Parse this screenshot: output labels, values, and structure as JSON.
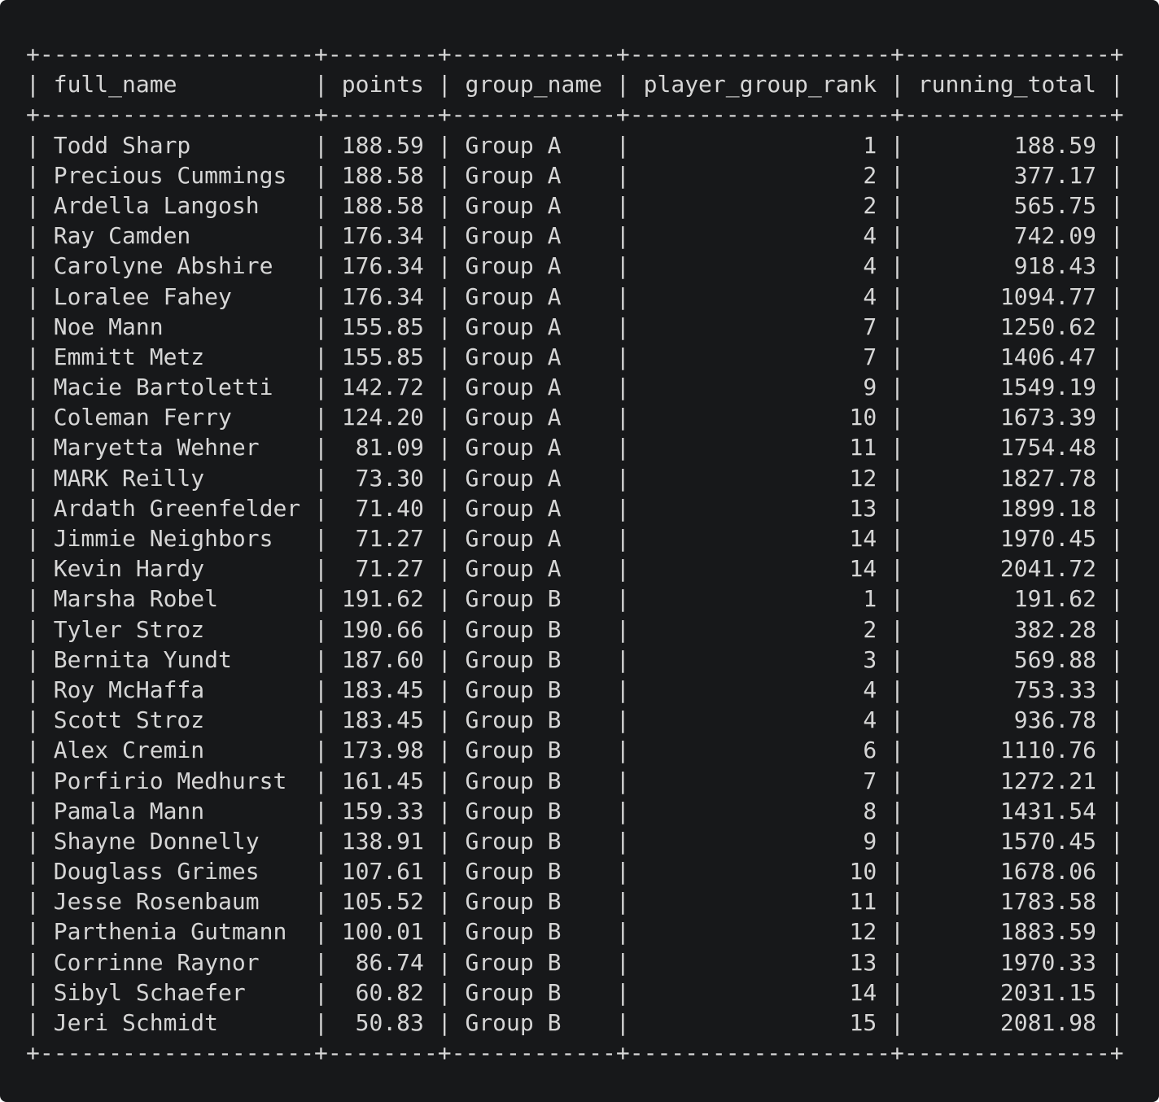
{
  "columns": [
    {
      "name": "full_name",
      "align": "left"
    },
    {
      "name": "points",
      "align": "right"
    },
    {
      "name": "group_name",
      "align": "left"
    },
    {
      "name": "player_group_rank",
      "align": "right"
    },
    {
      "name": "running_total",
      "align": "right"
    }
  ],
  "rows": [
    [
      "Todd Sharp",
      "188.59",
      "Group A",
      "1",
      "188.59"
    ],
    [
      "Precious Cummings",
      "188.58",
      "Group A",
      "2",
      "377.17"
    ],
    [
      "Ardella Langosh",
      "188.58",
      "Group A",
      "2",
      "565.75"
    ],
    [
      "Ray Camden",
      "176.34",
      "Group A",
      "4",
      "742.09"
    ],
    [
      "Carolyne Abshire",
      "176.34",
      "Group A",
      "4",
      "918.43"
    ],
    [
      "Loralee Fahey",
      "176.34",
      "Group A",
      "4",
      "1094.77"
    ],
    [
      "Noe Mann",
      "155.85",
      "Group A",
      "7",
      "1250.62"
    ],
    [
      "Emmitt Metz",
      "155.85",
      "Group A",
      "7",
      "1406.47"
    ],
    [
      "Macie Bartoletti",
      "142.72",
      "Group A",
      "9",
      "1549.19"
    ],
    [
      "Coleman Ferry",
      "124.20",
      "Group A",
      "10",
      "1673.39"
    ],
    [
      "Maryetta Wehner",
      "81.09",
      "Group A",
      "11",
      "1754.48"
    ],
    [
      "MARK Reilly",
      "73.30",
      "Group A",
      "12",
      "1827.78"
    ],
    [
      "Ardath Greenfelder",
      "71.40",
      "Group A",
      "13",
      "1899.18"
    ],
    [
      "Jimmie Neighbors",
      "71.27",
      "Group A",
      "14",
      "1970.45"
    ],
    [
      "Kevin Hardy",
      "71.27",
      "Group A",
      "14",
      "2041.72"
    ],
    [
      "Marsha Robel",
      "191.62",
      "Group B",
      "1",
      "191.62"
    ],
    [
      "Tyler Stroz",
      "190.66",
      "Group B",
      "2",
      "382.28"
    ],
    [
      "Bernita Yundt",
      "187.60",
      "Group B",
      "3",
      "569.88"
    ],
    [
      "Roy McHaffa",
      "183.45",
      "Group B",
      "4",
      "753.33"
    ],
    [
      "Scott Stroz",
      "183.45",
      "Group B",
      "4",
      "936.78"
    ],
    [
      "Alex Cremin",
      "173.98",
      "Group B",
      "6",
      "1110.76"
    ],
    [
      "Porfirio Medhurst",
      "161.45",
      "Group B",
      "7",
      "1272.21"
    ],
    [
      "Pamala Mann",
      "159.33",
      "Group B",
      "8",
      "1431.54"
    ],
    [
      "Shayne Donnelly",
      "138.91",
      "Group B",
      "9",
      "1570.45"
    ],
    [
      "Douglass Grimes",
      "107.61",
      "Group B",
      "10",
      "1678.06"
    ],
    [
      "Jesse Rosenbaum",
      "105.52",
      "Group B",
      "11",
      "1783.58"
    ],
    [
      "Parthenia Gutmann",
      "100.01",
      "Group B",
      "12",
      "1883.59"
    ],
    [
      "Corrinne Raynor",
      "86.74",
      "Group B",
      "13",
      "1970.33"
    ],
    [
      "Sibyl Schaefer",
      "60.82",
      "Group B",
      "14",
      "2031.15"
    ],
    [
      "Jeri Schmidt",
      "50.83",
      "Group B",
      "15",
      "2081.98"
    ]
  ]
}
